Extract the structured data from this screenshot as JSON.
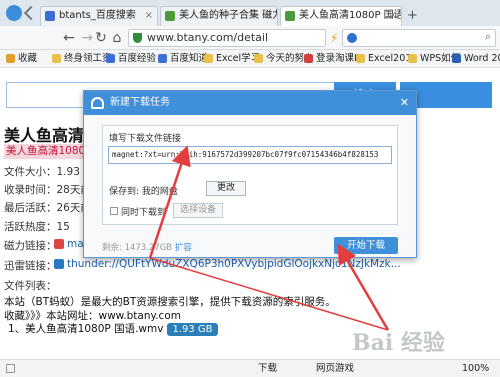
{
  "browser": {
    "tabs": [
      {
        "label": "btants_百度搜索",
        "icon_color": "#3b6fd6"
      },
      {
        "label": "美人鱼的种子合集 磁力链",
        "icon_color": "#4a9a3a"
      },
      {
        "label": "美人鱼高清1080P 国语.wm",
        "icon_color": "#4a9a3a"
      }
    ],
    "url": "www.btany.com/detail",
    "bookmarks": [
      "收藏",
      "终身领工资",
      "百度经验",
      "百度知道",
      "Excel学习",
      "今天的努力",
      "登录淘课IT",
      "Excel2013",
      "WPS如何",
      "Word 201"
    ]
  },
  "page": {
    "search_button_label": "搜索",
    "title": "美人鱼高清1080P",
    "subtitle": "美人鱼高清1080P 国语",
    "file_size_label": "文件大小：",
    "file_size_value": "1.93 G",
    "created_label": "收录时间：",
    "created_value": "28天前",
    "last_active_label": "最后活跃：",
    "last_active_value": "26天前",
    "heat_label": "活跃热度：",
    "heat_value": "15",
    "magnet_label": "磁力链接：",
    "magnet_value": "mag",
    "thunder_label": "迅雷链接：",
    "thunder_link": "thunder://QUFtYWduZXQ6P3h0PXVybjpidGlOojkxNjc1NzJkMzk...",
    "file_list_label": "文件列表：",
    "about_text": "本站（BT蚂蚁）是最大的BT资源搜索引擎，提供下载资源的索引服务。",
    "collect_text": "收藏》》》本站网址：www.btany.com",
    "file_item": "1、美人鱼高清1080P 国语.wmv",
    "file_item_size": "1.93 GB"
  },
  "dialog": {
    "title": "新建下载任务",
    "close_label": "✕",
    "link_label": "填写下载文件链接",
    "link_value": "magnet:?xt=urn:btih:9167572d399207bc07f9fc07154346b4f828153",
    "save_label": "保存到: 我的网盘",
    "change_label": "更改",
    "sync_label": "同时下载到",
    "select_device_label": "选择设备",
    "space_text": "剩余: 1473.27GB",
    "expand_label": "扩容",
    "start_label": "开始下载"
  },
  "statusbar": {
    "zoom": "100%",
    "items": [
      "下载",
      "网页游戏"
    ]
  },
  "watermark": "Bai 经验"
}
